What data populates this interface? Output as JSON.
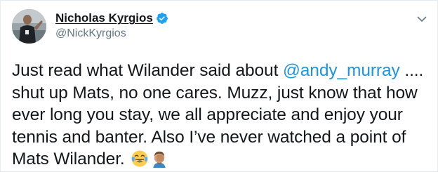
{
  "tweet": {
    "author": {
      "display_name": "Nicholas Kyrgios",
      "handle": "@NickKyrgios",
      "verified": true,
      "avatar_icon": "avatar-photo-icon"
    },
    "body": {
      "part1": "Just read what Wilander said about ",
      "mention": "@andy_murray",
      "part2": " .... shut up Mats, no one cares. Muzz, just know that how ever long you stay, we all appreciate and enjoy your tennis and banter. Also I’ve never watched a point of Mats Wilander. ",
      "emojis": [
        "face-with-tears-of-joy-emoji",
        "man-facepalming-emoji"
      ]
    },
    "menu_icon": "chevron-down-icon"
  },
  "colors": {
    "link": "#1b95e0",
    "text": "#14171a",
    "secondary": "#657786",
    "verified": "#1da1f2",
    "border": "#e6ecf0"
  }
}
